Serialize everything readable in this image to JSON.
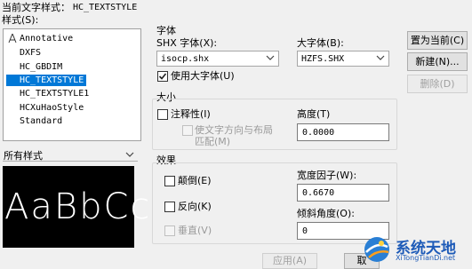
{
  "header": {
    "current_style_label": "当前文字样式：",
    "current_style_value": "HC_TEXTSTYLE",
    "styles_label": "样式(S):"
  },
  "style_list": [
    {
      "name": "Annotative",
      "annotative": true
    },
    {
      "name": "DXFS"
    },
    {
      "name": "HC_GBDIM"
    },
    {
      "name": "HC_TEXTSTYLE",
      "selected": true
    },
    {
      "name": "HC_TEXTSTYLE1"
    },
    {
      "name": "HCXuHaoStyle"
    },
    {
      "name": "Standard"
    }
  ],
  "filter": {
    "value": "所有样式"
  },
  "preview": {
    "text": "AaBbCc"
  },
  "font": {
    "group_label": "字体",
    "shx_label": "SHX 字体(X):",
    "shx_value": "isocp.shx",
    "bigfont_label": "大字体(B):",
    "bigfont_value": "HZFS.SHX",
    "use_bigfont_label": "使用大字体(U)",
    "use_bigfont_checked": true
  },
  "size": {
    "group_label": "大小",
    "annotative_label": "注释性(I)",
    "match_line1": "使文字方向与布局",
    "match_line2": "匹配(M)",
    "height_label": "高度(T)",
    "height_value": "0.0000"
  },
  "effects": {
    "group_label": "效果",
    "upside_down_label": "颠倒(E)",
    "backwards_label": "反向(K)",
    "vertical_label": "垂直(V)",
    "width_factor_label": "宽度因子(W):",
    "width_factor_value": "0.6670",
    "oblique_label": "倾斜角度(O):",
    "oblique_value": "0"
  },
  "buttons": {
    "set_current": "置为当前(C)",
    "new": "新建(N)...",
    "delete": "删除(D)",
    "apply": "应用(A)",
    "close": "取"
  },
  "watermark": {
    "title": "系统天地",
    "url": "XiTongTianDi.net"
  },
  "colors": {
    "selection": "#0078d7",
    "preview_bg": "#000000",
    "watermark": "#1e5bb8"
  }
}
